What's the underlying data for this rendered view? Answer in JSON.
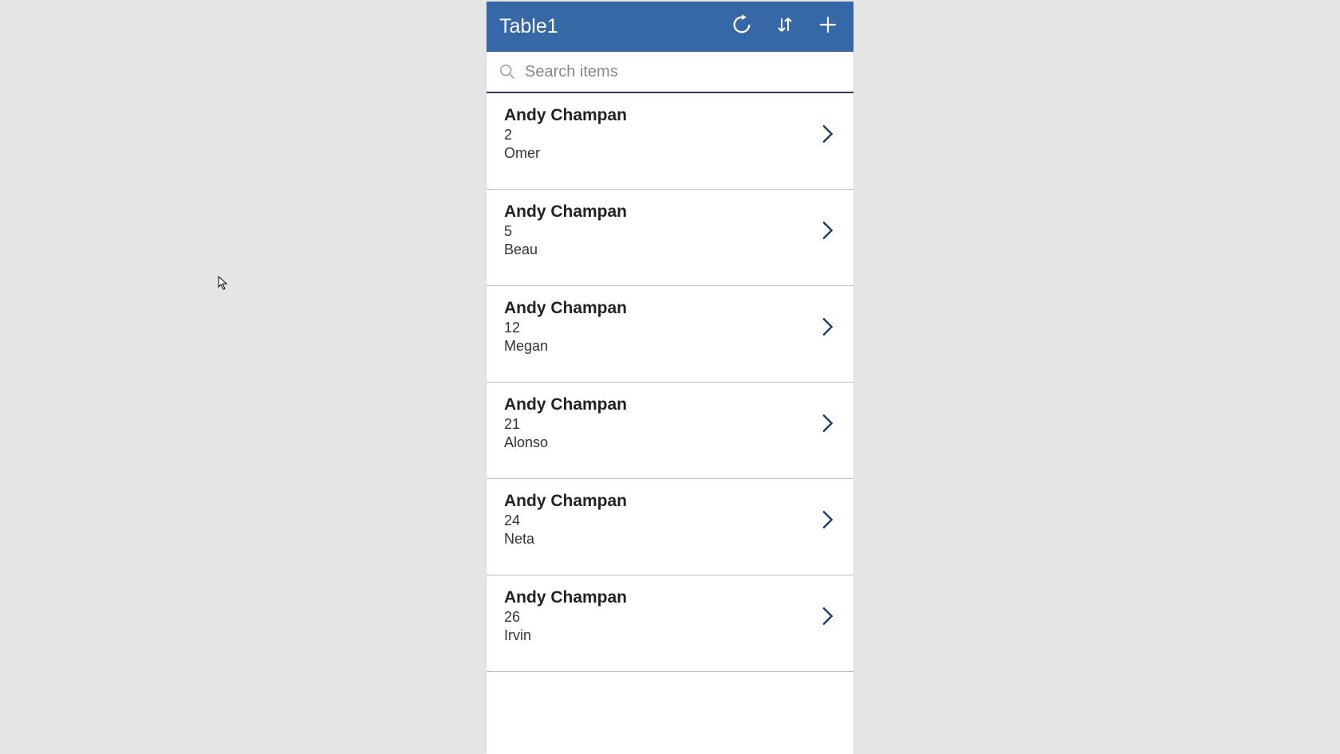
{
  "header": {
    "title": "Table1"
  },
  "search": {
    "placeholder": "Search items",
    "value": ""
  },
  "items": [
    {
      "title": "Andy Champan",
      "line2": "2",
      "line3": "Omer"
    },
    {
      "title": "Andy Champan",
      "line2": "5",
      "line3": "Beau"
    },
    {
      "title": "Andy Champan",
      "line2": "12",
      "line3": "Megan"
    },
    {
      "title": "Andy Champan",
      "line2": "21",
      "line3": "Alonso"
    },
    {
      "title": "Andy Champan",
      "line2": "24",
      "line3": "Neta"
    },
    {
      "title": "Andy Champan",
      "line2": "26",
      "line3": "Irvin"
    }
  ]
}
